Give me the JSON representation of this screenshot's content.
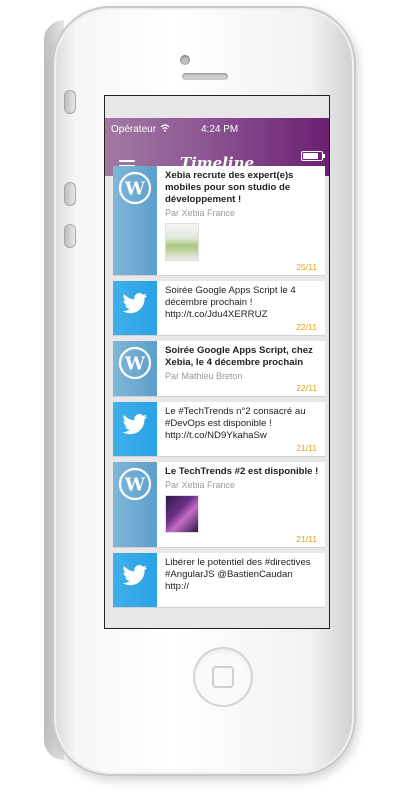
{
  "status_bar": {
    "carrier": "Opérateur",
    "time": "4:24 PM"
  },
  "nav": {
    "title": "Timeline"
  },
  "feed": [
    {
      "type": "wordpress",
      "title": "Xebia recrute des expert(e)s mobiles pour son studio de développement !",
      "author": "Par Xebia France",
      "date": "25/11",
      "has_thumb": true
    },
    {
      "type": "twitter",
      "title": "Soirée Google Apps Script le 4 décembre prochain ! http://t.co/Jdu4XERRUZ",
      "author": "",
      "date": "22/11",
      "has_thumb": false
    },
    {
      "type": "wordpress",
      "title": "Soirée Google Apps Script, chez Xebia, le 4 décembre prochain",
      "author": "Par Mathieu Breton",
      "date": "22/11",
      "has_thumb": false
    },
    {
      "type": "twitter",
      "title": "Le #TechTrends n°2 consacré au #DevOps est disponible ! http://t.co/ND9YkahaSw",
      "author": "",
      "date": "21/11",
      "has_thumb": false
    },
    {
      "type": "wordpress",
      "title": "Le TechTrends #2 est disponible !",
      "author": "Par Xebia France",
      "date": "21/11",
      "has_thumb": true
    },
    {
      "type": "twitter",
      "title": "Libérer le potentiel des #directives #AngularJS @BastienCaudan http://",
      "author": "",
      "date": "",
      "has_thumb": false
    }
  ]
}
